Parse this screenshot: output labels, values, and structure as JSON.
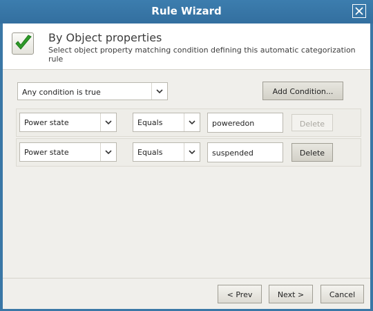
{
  "window": {
    "title": "Rule Wizard"
  },
  "header": {
    "title": "By Object properties",
    "subtitle": "Select object property matching condition defining this automatic categorization rule"
  },
  "match_mode": {
    "selected": "Any condition is true"
  },
  "add_condition_label": "Add Condition...",
  "conditions": [
    {
      "property": "Power state",
      "operator": "Equals",
      "value": "poweredon",
      "delete_label": "Delete",
      "delete_enabled": false
    },
    {
      "property": "Power state",
      "operator": "Equals",
      "value": "suspended",
      "delete_label": "Delete",
      "delete_enabled": true
    }
  ],
  "footer": {
    "prev_label": "< Prev",
    "next_label": "Next >",
    "cancel_label": "Cancel"
  },
  "colors": {
    "title_bar": "#3a77a6",
    "dialog_bg": "#f0efeb",
    "check_green": "#2f9a2a"
  }
}
